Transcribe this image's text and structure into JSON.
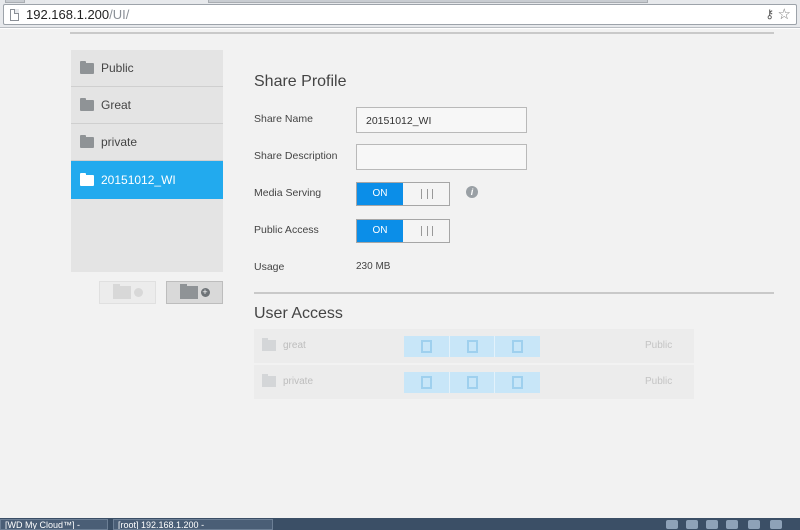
{
  "browser": {
    "url_host": "192.168.1.200",
    "url_path": "/UI/"
  },
  "sidebar": {
    "shares": [
      {
        "name": "Public",
        "active": false
      },
      {
        "name": "Great",
        "active": false
      },
      {
        "name": "private",
        "active": false
      },
      {
        "name": "20151012_WI",
        "active": true
      }
    ]
  },
  "share_profile": {
    "title": "Share Profile",
    "share_name_label": "Share Name",
    "share_name_value": "20151012_WI",
    "share_description_label": "Share Description",
    "share_description_value": "",
    "media_serving_label": "Media Serving",
    "media_serving_state": "ON",
    "public_access_label": "Public Access",
    "public_access_state": "ON",
    "usage_label": "Usage",
    "usage_value": "230 MB"
  },
  "user_access": {
    "title": "User Access",
    "rows": [
      {
        "user": "great",
        "type": "Public"
      },
      {
        "user": "private",
        "type": "Public"
      }
    ]
  },
  "taskbar": {
    "tasks": [
      "[WD My Cloud™] -",
      "[root] 192.168.1.200 -"
    ]
  },
  "colors": {
    "accent": "#22aaee",
    "toggle_on": "#0b8ee8"
  }
}
